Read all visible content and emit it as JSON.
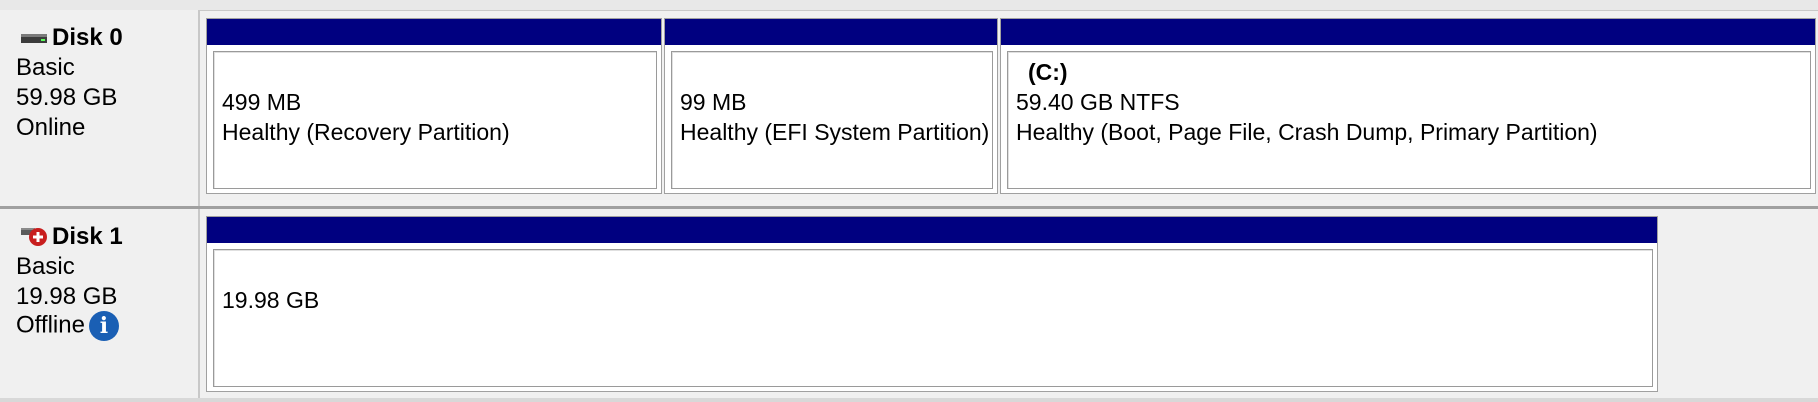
{
  "disks": [
    {
      "name": "Disk 0",
      "type": "Basic",
      "size": "59.98 GB",
      "status": "Online",
      "icon": "disk-icon",
      "partitions": [
        {
          "size": "499 MB",
          "health": "Healthy (Recovery Partition)"
        },
        {
          "size": "99 MB",
          "health": "Healthy (EFI System Partition)"
        },
        {
          "volume": "(C:)",
          "size": "59.40 GB NTFS",
          "health": "Healthy (Boot, Page File, Crash Dump, Primary Partition)"
        }
      ]
    },
    {
      "name": "Disk 1",
      "type": "Basic",
      "size": "19.98 GB",
      "status": "Offline",
      "icon": "disk-offline-icon",
      "status_icon": "info-icon",
      "partitions": [
        {
          "size": "19.98 GB"
        }
      ]
    }
  ],
  "colors": {
    "partition_bar": "#000080",
    "offline_badge": "#c81e1e",
    "info_badge": "#1a5fb4"
  }
}
